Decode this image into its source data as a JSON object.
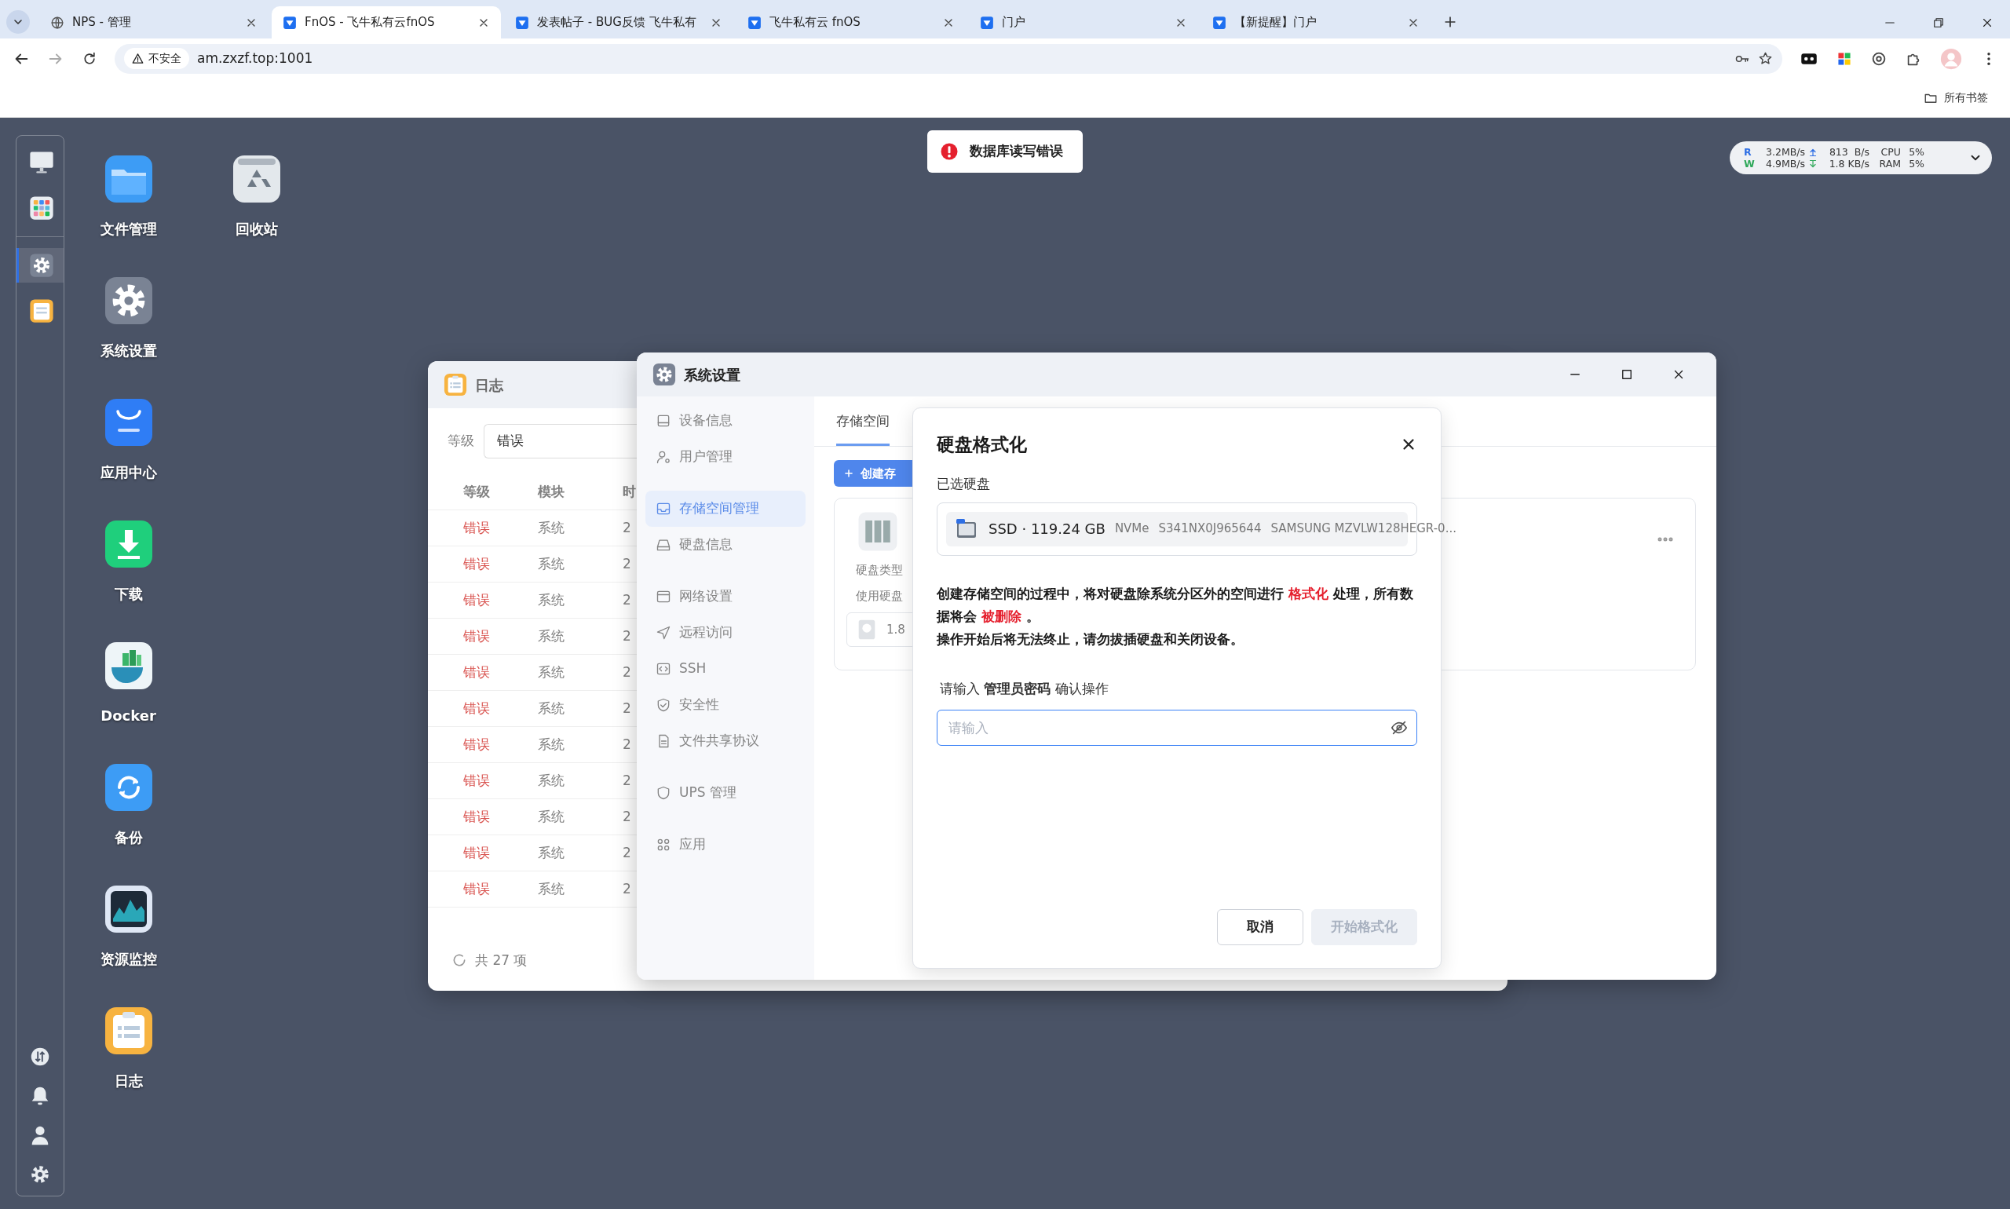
{
  "browser": {
    "tabs": [
      {
        "title": "NPS - 管理",
        "kind": "globe",
        "selected": false
      },
      {
        "title": "FnOS - 飞牛私有云fnOS",
        "kind": "fnos",
        "selected": true
      },
      {
        "title": "发表帖子 - BUG反馈 飞牛私有",
        "kind": "fnos",
        "selected": false
      },
      {
        "title": "飞牛私有云 fnOS",
        "kind": "fnos",
        "selected": false
      },
      {
        "title": "门户",
        "kind": "fnos",
        "selected": false
      },
      {
        "title": "【新提醒】门户",
        "kind": "fnos",
        "selected": false
      }
    ],
    "address": {
      "security": "不安全",
      "url": "am.zxzf.top:1001"
    },
    "bookmarks": {
      "label": "所有书签"
    }
  },
  "toast": {
    "message": "数据库读写错误"
  },
  "stats": [
    {
      "label": "R",
      "disk": "3.2MB/s",
      "kind": "up",
      "net": "813  B/s",
      "metric": "CPU",
      "value": "5%"
    },
    {
      "label": "W",
      "disk": "4.9MB/s",
      "kind": "down",
      "net": "1.8 KB/s",
      "metric": "RAM",
      "value": "5%"
    }
  ],
  "dock": {
    "top": [
      {
        "kind": "desktop",
        "selected": false
      },
      {
        "kind": "apps",
        "selected": false
      },
      {
        "kind": "settings",
        "selected": true
      },
      {
        "kind": "log",
        "selected": false
      }
    ],
    "bottom": [
      {
        "kind": "transfer"
      },
      {
        "kind": "bell"
      },
      {
        "kind": "user"
      },
      {
        "kind": "gear"
      }
    ]
  },
  "desktop_icons": [
    {
      "label": "文件管理",
      "kind": "files"
    },
    {
      "label": "系统设置",
      "kind": "settings"
    },
    {
      "label": "应用中心",
      "kind": "store"
    },
    {
      "label": "下载",
      "kind": "download"
    },
    {
      "label": "Docker",
      "kind": "docker"
    },
    {
      "label": "备份",
      "kind": "backup"
    },
    {
      "label": "资源监控",
      "kind": "monitor"
    },
    {
      "label": "日志",
      "kind": "log"
    },
    {
      "label": "回收站",
      "kind": "recycle"
    }
  ],
  "log_window": {
    "title": "日志",
    "filter": {
      "label": "等级",
      "value": "错误"
    },
    "table": {
      "columns": [
        "等级",
        "模块",
        "时"
      ],
      "rows": [
        [
          "错误",
          "系统",
          "2"
        ],
        [
          "错误",
          "系统",
          "2"
        ],
        [
          "错误",
          "系统",
          "2"
        ],
        [
          "错误",
          "系统",
          "2"
        ],
        [
          "错误",
          "系统",
          "2"
        ],
        [
          "错误",
          "系统",
          "2"
        ],
        [
          "错误",
          "系统",
          "2"
        ],
        [
          "错误",
          "系统",
          "2"
        ],
        [
          "错误",
          "系统",
          "2"
        ],
        [
          "错误",
          "系统",
          "2"
        ],
        [
          "错误",
          "系统",
          "2"
        ]
      ]
    },
    "footer": "共 27 项"
  },
  "settings_window": {
    "title": "系统设置",
    "sidebar": {
      "groups": [
        {
          "items": [
            {
              "label": "设备信息",
              "kind": "device",
              "selected": false
            },
            {
              "label": "用户管理",
              "kind": "user",
              "selected": false
            }
          ]
        },
        {
          "items": [
            {
              "label": "存储空间管理",
              "kind": "storage",
              "selected": true
            },
            {
              "label": "硬盘信息",
              "kind": "disk",
              "selected": false
            }
          ]
        },
        {
          "items": [
            {
              "label": "网络设置",
              "kind": "network",
              "selected": false
            },
            {
              "label": "远程访问",
              "kind": "remote",
              "selected": false
            },
            {
              "label": "SSH",
              "kind": "ssh",
              "selected": false
            },
            {
              "label": "安全性",
              "kind": "security",
              "selected": false
            },
            {
              "label": "文件共享协议",
              "kind": "share",
              "selected": false
            }
          ]
        },
        {
          "items": [
            {
              "label": "UPS 管理",
              "kind": "ups",
              "selected": false
            }
          ]
        },
        {
          "items": [
            {
              "label": "应用",
              "kind": "apps",
              "selected": false
            }
          ]
        }
      ]
    },
    "tabs": [
      {
        "label": "存储空间",
        "selected": true
      }
    ],
    "create_button": "创建存",
    "card": {
      "type_label": "硬盘类型",
      "disks_label": "使用硬盘",
      "disk_size": "1.8"
    }
  },
  "dialog": {
    "title": "硬盘格式化",
    "disk_label": "已选硬盘",
    "disk": {
      "name": "SSD · 119.24 GB",
      "interface": "NVMe",
      "serial": "S341NX0J965644",
      "model": "SAMSUNG MZVLW128HEGR-0..."
    },
    "warning": [
      [
        {
          "text": "创建存储空间的过程中，将对硬盘除系统分区外的空间进行 ",
          "highlight": false
        },
        {
          "text": "格式化",
          "highlight": true
        },
        {
          "text": " 处理，所有数据将会 ",
          "highlight": false
        },
        {
          "text": "被删除",
          "highlight": true
        },
        {
          "text": " 。",
          "highlight": false
        }
      ],
      [
        {
          "text": "操作开始后将无法终止，请勿拔插硬盘和关闭设备。",
          "highlight": false
        }
      ]
    ],
    "prompt": "请输入 **管理员密码** 确认操作",
    "password": {
      "placeholder": "请输入"
    },
    "buttons": [
      {
        "label": "取消",
        "kind": "secondary",
        "disabled": false
      },
      {
        "label": "开始格式化",
        "kind": "primary",
        "disabled": true
      }
    ]
  }
}
